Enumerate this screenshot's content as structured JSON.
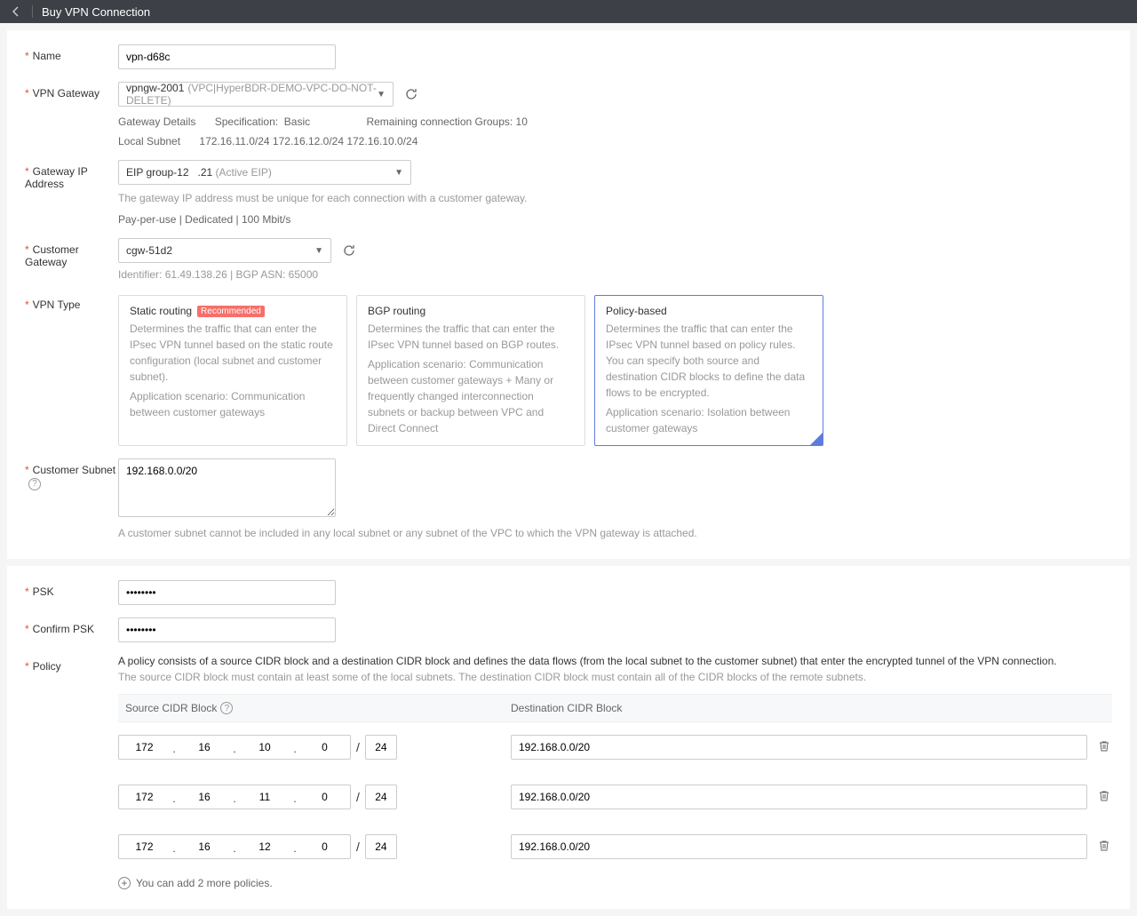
{
  "header": {
    "title": "Buy VPN Connection"
  },
  "form": {
    "name": {
      "label": "Name",
      "value": "vpn-d68c"
    },
    "vpnGateway": {
      "label": "VPN Gateway",
      "selected": "vpngw-2001",
      "selectedSub": "(VPC|HyperBDR-DEMO-VPC-DO-NOT-DELETE)",
      "details": {
        "gatewayDetails": "Gateway Details",
        "specLabel": "Specification:",
        "specValue": "Basic",
        "remaining": "Remaining connection Groups: 10",
        "localSubnetLabel": "Local Subnet",
        "localSubnets": "172.16.11.0/24 172.16.12.0/24 172.16.10.0/24"
      }
    },
    "gatewayIP": {
      "label": "Gateway IP Address",
      "group": "EIP group-12",
      "ip": ".21",
      "status": "(Active EIP)",
      "hint": "The gateway IP address must be unique for each connection with a customer gateway.",
      "billing": "Pay-per-use | Dedicated | 100 Mbit/s"
    },
    "customerGateway": {
      "label": "Customer Gateway",
      "selected": "cgw-51d2",
      "identifier": "Identifier: 61.49.138.26 | BGP ASN: 65000"
    },
    "vpnType": {
      "label": "VPN Type",
      "selected": 2,
      "options": [
        {
          "title": "Static routing",
          "recommended": "Recommended",
          "desc": "Determines the traffic that can enter the IPsec VPN tunnel based on the static route configuration (local subnet and customer subnet).",
          "scenario": "Application scenario: Communication between customer gateways"
        },
        {
          "title": "BGP routing",
          "desc": "Determines the traffic that can enter the IPsec VPN tunnel based on BGP routes.",
          "scenario": "Application scenario: Communication between customer gateways + Many or frequently changed interconnection subnets or backup between VPC and Direct Connect"
        },
        {
          "title": "Policy-based",
          "desc": "Determines the traffic that can enter the IPsec VPN tunnel based on policy rules. You can specify both source and destination CIDR blocks to define the data flows to be encrypted.",
          "scenario": "Application scenario: Isolation between customer gateways"
        }
      ]
    },
    "customerSubnet": {
      "label": "Customer Subnet",
      "value": "192.168.0.0/20",
      "hint": "A customer subnet cannot be included in any local subnet or any subnet of the VPC to which the VPN gateway is attached."
    },
    "psk": {
      "label": "PSK",
      "value": "••••••••"
    },
    "confirmPsk": {
      "label": "Confirm PSK",
      "value": "••••••••"
    },
    "policy": {
      "label": "Policy",
      "desc": "A policy consists of a source CIDR block and a destination CIDR block and defines the data flows (from the local subnet to the customer subnet) that enter the encrypted tunnel of the VPN connection.",
      "hint": "The source CIDR block must contain at least some of the local subnets. The destination CIDR block must contain all of the CIDR blocks of the remote subnets.",
      "headers": {
        "src": "Source CIDR Block",
        "dst": "Destination CIDR Block"
      },
      "rows": [
        {
          "o1": "172",
          "o2": "16",
          "o3": "10",
          "o4": "0",
          "mask": "24",
          "dst": "192.168.0.0/20"
        },
        {
          "o1": "172",
          "o2": "16",
          "o3": "11",
          "o4": "0",
          "mask": "24",
          "dst": "192.168.0.0/20"
        },
        {
          "o1": "172",
          "o2": "16",
          "o3": "12",
          "o4": "0",
          "mask": "24",
          "dst": "192.168.0.0/20"
        }
      ],
      "addText": "You can add 2 more policies."
    }
  }
}
